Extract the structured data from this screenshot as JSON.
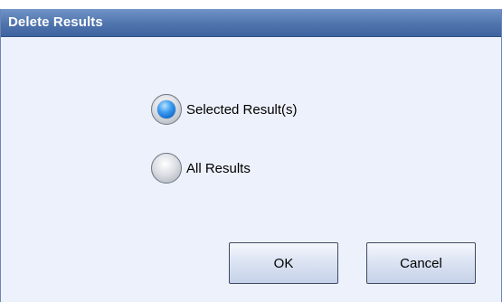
{
  "dialog": {
    "title": "Delete Results"
  },
  "options": [
    {
      "label": "Selected Result(s)",
      "selected": true
    },
    {
      "label": "All Results",
      "selected": false
    }
  ],
  "buttons": {
    "ok_label": "OK",
    "cancel_label": "Cancel"
  },
  "colors": {
    "title_bar": "#4f74ad",
    "dialog_background": "#edf1fb",
    "radio_selected": "#1f7fe0"
  }
}
